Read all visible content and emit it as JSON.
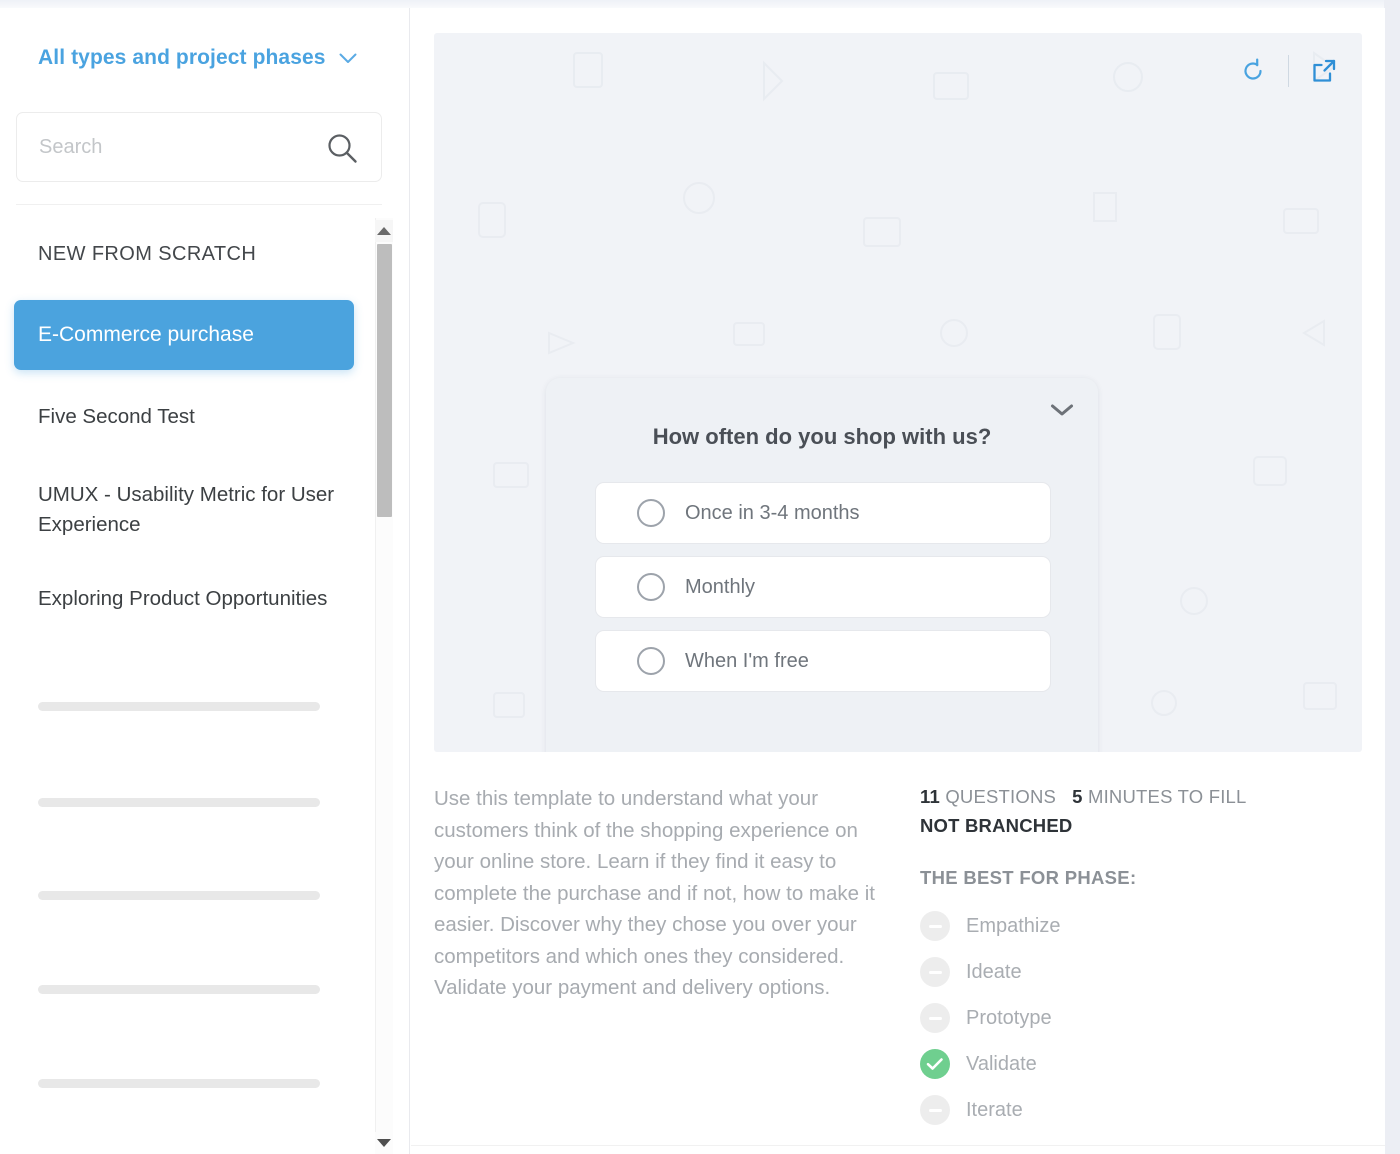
{
  "sidebar": {
    "filter": {
      "label": "All types and project phases",
      "icon": "chevron-down-icon"
    },
    "search": {
      "placeholder": "Search",
      "value": "",
      "icon": "search-icon"
    },
    "list_header": "NEW FROM SCRATCH",
    "items": [
      {
        "label": "E-Commerce purchase",
        "selected": true
      },
      {
        "label": "Five Second Test",
        "selected": false
      },
      {
        "label": "UMUX - Usability Metric for User Experience",
        "selected": false
      },
      {
        "label": "Exploring Product Opportunities",
        "selected": false
      }
    ],
    "placeholder_rows": 5,
    "scrollbar": {
      "up_icon": "triangle-up-icon",
      "down_icon": "triangle-down-icon"
    }
  },
  "preview": {
    "actions": [
      {
        "name": "refresh-icon",
        "title": "Refresh"
      },
      {
        "name": "open-external-icon",
        "title": "Open in new window"
      }
    ],
    "question_card": {
      "collapse_icon": "chevron-down-icon",
      "title": "How often do you shop with us?",
      "options": [
        "Once in 3-4 months",
        "Monthly",
        "When I'm free"
      ]
    }
  },
  "details": {
    "description": "Use this template to understand what your customers think of the shopping experience on your online store. Learn if they find it easy to complete the purchase and if not, how to make it easier. Discover why they chose you over your competitors and which ones they considered. Validate your payment and delivery options.",
    "questions_count": "11",
    "questions_label": "QUESTIONS",
    "minutes_count": "5",
    "minutes_label": "MINUTES TO FILL",
    "branching": "NOT BRANCHED",
    "phases_title": "THE BEST FOR PHASE:",
    "phases": [
      {
        "label": "Empathize",
        "active": false
      },
      {
        "label": "Ideate",
        "active": false
      },
      {
        "label": "Prototype",
        "active": false
      },
      {
        "label": "Validate",
        "active": true
      },
      {
        "label": "Iterate",
        "active": false
      }
    ]
  },
  "colors": {
    "accent_blue": "#4ba3de",
    "link_blue": "#4aa3e0",
    "active_green": "#6fcf8f",
    "preview_bg": "#f1f3f7",
    "card_bg": "#eef1f5"
  }
}
